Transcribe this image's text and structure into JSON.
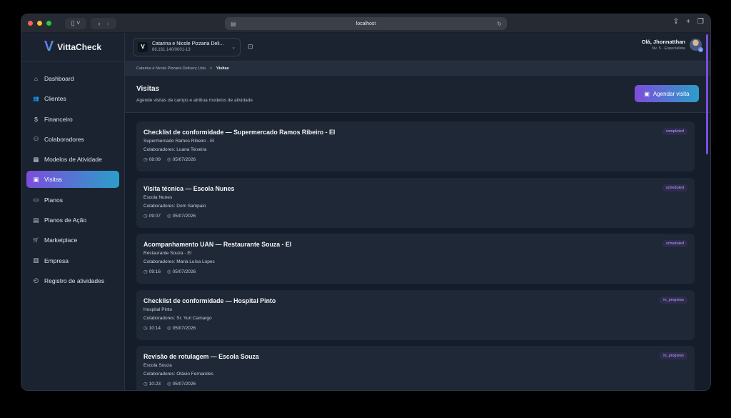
{
  "browser": {
    "url": "localhost"
  },
  "brand": {
    "name": "VittaCheck",
    "mark": "V"
  },
  "nav": [
    {
      "icon": "⌂",
      "label": "Dashboard"
    },
    {
      "icon": "👥",
      "label": "Clientes"
    },
    {
      "icon": "$",
      "label": "Financeiro"
    },
    {
      "icon": "⚇",
      "label": "Colaboradores"
    },
    {
      "icon": "▦",
      "label": "Modelos de Atividade"
    },
    {
      "icon": "▣",
      "label": "Visitas"
    },
    {
      "icon": "▭",
      "label": "Planos"
    },
    {
      "icon": "▤",
      "label": "Planos de Ação"
    },
    {
      "icon": "🛒",
      "label": "Marketplace"
    },
    {
      "icon": "▥",
      "label": "Empresa"
    },
    {
      "icon": "◴",
      "label": "Registro de atividades"
    }
  ],
  "company": {
    "logo": "V",
    "name": "Catarina e Nicole Pizzaria Deli...",
    "cnpj": "86.161.140/0001-13"
  },
  "user": {
    "greeting": "Olá, Jhonnatthan",
    "level": "Nv. 5 - Especialista",
    "badge": "5"
  },
  "breadcrumb": {
    "parent": "Catarina e Nicole Pizzaria Delivery Ltda",
    "separator": ">",
    "current": "Visitas"
  },
  "page": {
    "title": "Visitas",
    "subtitle": "Agende visitas de campo e atribua modelos de atividade",
    "action_label": "Agendar visita"
  },
  "visits": [
    {
      "title": "Checklist de conformidade — Supermercado Ramos Ribeiro - EI",
      "client": "Supermercado Ramos Ribeiro - EI",
      "collaborators": "Colaboradores: Luana Teixeira",
      "time": "08:09",
      "date": "05/07/2026",
      "status": "completed"
    },
    {
      "title": "Visita técnica — Escola Nunes",
      "client": "Escola Nunes",
      "collaborators": "Colaboradores: Dom Sampaio",
      "time": "09:07",
      "date": "05/07/2026",
      "status": "scheduled"
    },
    {
      "title": "Acompanhamento UAN — Restaurante Souza - EI",
      "client": "Restaurante Souza - EI",
      "collaborators": "Colaboradores: Maria Luísa Lopes",
      "time": "09:16",
      "date": "05/07/2026",
      "status": "scheduled"
    },
    {
      "title": "Checklist de conformidade — Hospital Pinto",
      "client": "Hospital Pinto",
      "collaborators": "Colaboradores: Sr. Yuri Camargo",
      "time": "10:14",
      "date": "05/07/2026",
      "status": "in_progress"
    },
    {
      "title": "Revisão de rotulagem — Escola Souza",
      "client": "Escola Souza",
      "collaborators": "Colaboradores: Otávio Fernandes",
      "time": "10:23",
      "date": "05/07/2026",
      "status": "in_progress"
    }
  ],
  "colors": {
    "accent_start": "#7c4ddb",
    "accent_end": "#2b9ec9",
    "status_bg": "#2e2b4c",
    "status_text": "#b9a6ff"
  }
}
